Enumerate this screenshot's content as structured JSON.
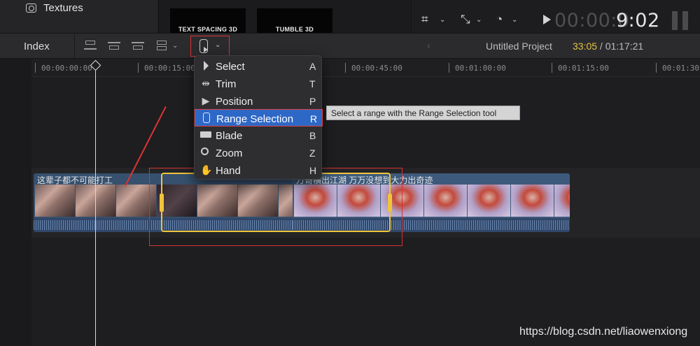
{
  "top": {
    "textures_label": "Textures",
    "thumbnails": [
      "TEXT SPACING 3D",
      "TUMBLE 3D"
    ],
    "timecode_dim": "00:00:0",
    "timecode_bright": "9:02"
  },
  "toolbar": {
    "index_label": "Index",
    "back_arrow": "‹",
    "project_title": "Untitled Project",
    "project_current": "33:05",
    "project_total": " / 01:17:21"
  },
  "ruler": {
    "labels": [
      "00:00:00:00",
      "00:00:15:00",
      "00:00:45:00",
      "00:01:00:00",
      "00:01:15:00",
      "00:01:30"
    ]
  },
  "tool_menu": {
    "items": [
      {
        "label": "Select",
        "key": "A",
        "icon": "arrow-icon"
      },
      {
        "label": "Trim",
        "key": "T",
        "icon": "trim-icon"
      },
      {
        "label": "Position",
        "key": "P",
        "icon": "position-icon"
      },
      {
        "label": "Range Selection",
        "key": "R",
        "icon": "range-selection-icon"
      },
      {
        "label": "Blade",
        "key": "B",
        "icon": "blade-icon"
      },
      {
        "label": "Zoom",
        "key": "Z",
        "icon": "zoom-icon"
      },
      {
        "label": "Hand",
        "key": "H",
        "icon": "hand-icon"
      }
    ],
    "selected_index": 3
  },
  "tooltip": "Select a range with the Range Selection tool",
  "clips": [
    {
      "title": "这辈子都不可能打工"
    },
    {
      "title": "万哥横出江湖 万万没想到大力出奇迹"
    }
  ],
  "watermark": "https://blog.csdn.net/liaowenxiong",
  "colors": {
    "accent_blue": "#2e68c7",
    "range_yellow": "#efc43a",
    "annotation_red": "#d73232",
    "duration_yellow": "#e3c341"
  }
}
